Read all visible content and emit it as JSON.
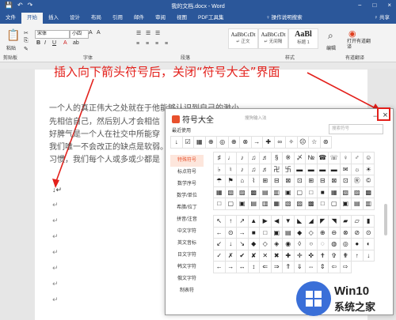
{
  "window": {
    "title": "我的文档.docx - Word",
    "qat_icons": [
      "save-icon",
      "undo-icon",
      "redo-icon"
    ],
    "controls": [
      "−",
      "□",
      "×"
    ]
  },
  "ribbon_tabs": {
    "items": [
      "文件",
      "开始",
      "插入",
      "设计",
      "布局",
      "引用",
      "邮件",
      "审阅",
      "视图",
      "PDF工具集"
    ],
    "active": "开始",
    "tell_me": "♀ 操作说明搜索",
    "share": "♀ 共享"
  },
  "ribbon": {
    "paste": "粘贴",
    "clipboard": "剪贴板",
    "font_name": "宋体",
    "font_size": "小四",
    "font": "字体",
    "paragraph": "段落",
    "styles": [
      {
        "preview": "AaBbCcDt",
        "name": "↵ 正文"
      },
      {
        "preview": "AaBbCcDt",
        "name": "↵ 无间隔"
      },
      {
        "preview": "AaBl",
        "name": "标题 1"
      }
    ],
    "styles_label": "样式",
    "edit": "编辑",
    "open_youdao": "打开有道翻译",
    "youdao_label": "有道翻译"
  },
  "annotation": "插入向下箭头符号后，关闭“符号大全”界面",
  "document": {
    "lines": [
      "一个人的真正伟大之处就在于他能够认识到自己的渺小。",
      "先相信自己，然后别人才会相信",
      "好脾气是一个人在社交中所能穿",
      "我们唯一不会改正的缺点是软弱。",
      "习惯，我们每个人或多或少都是"
    ],
    "inserted_arrow": "↓↵",
    "para_mark": "↵"
  },
  "dialog": {
    "title": "符号大全",
    "subtitle": "搜狗输入法",
    "minimize": "−",
    "close": "×",
    "recent_label": "最近使用",
    "search_placeholder": "搜索符号",
    "recent": [
      "↓",
      "☑",
      "▦",
      "⊕",
      "◎",
      "⊕",
      "⊗",
      "→",
      "✚",
      "∞",
      "✧",
      "☹",
      "☆",
      "⊛"
    ],
    "categories": [
      "特殊符号",
      "标点符号",
      "数学序号",
      "数学/单位",
      "希腊/拉丁",
      "拼音/注音",
      "中文字符",
      "英文音标",
      "日文字符",
      "韩文字符",
      "俄文字符",
      "制表符"
    ],
    "active_category": "特殊符号",
    "grid_top": [
      "♯",
      "♩",
      "♪",
      "♫",
      "♬",
      "§",
      "※",
      "〆",
      "№",
      "☎",
      "☏",
      "♀",
      "♂",
      "☺",
      "♭",
      "♮",
      "♪",
      "♫",
      "♬",
      "卍",
      "卐",
      "▬",
      "▬",
      "▬",
      "▬",
      "✉",
      "☼",
      "☀",
      "☂",
      "⚑",
      "⌂",
      "⌇",
      "⊞",
      "⊟",
      "⊠",
      "⊡",
      "⊞",
      "⊟",
      "⊠",
      "⊡",
      "Ⓡ",
      "©",
      "▦",
      "▧",
      "▨",
      "▩",
      "▤",
      "▥",
      "▣",
      "▢",
      "□",
      "■",
      "▦",
      "▧",
      "▨",
      "▩",
      "□",
      "▢",
      "▣",
      "▤",
      "▥",
      "▦",
      "▧",
      "▨",
      "▩",
      "□",
      "▢",
      "▣",
      "▤",
      "▥"
    ],
    "grid_bottom": [
      "↖",
      "↑",
      "↗",
      "▲",
      "▶",
      "◀",
      "▼",
      "◣",
      "◢",
      "◤",
      "◥",
      "▰",
      "▱",
      "▮",
      "←",
      "⊙",
      "→",
      "■",
      "□",
      "▣",
      "▤",
      "◆",
      "◇",
      "⊕",
      "⊖",
      "⊗",
      "⊘",
      "⊙",
      "↙",
      "↓",
      "↘",
      "◆",
      "◇",
      "◈",
      "◉",
      "◊",
      "○",
      "◌",
      "◍",
      "◎",
      "●",
      "◐",
      "✓",
      "✗",
      "✔",
      "✘",
      "✕",
      "✖",
      "✚",
      "✛",
      "✜",
      "✝",
      "✞",
      "✟",
      "↑",
      "↓",
      "←",
      "→",
      "↔",
      "↕",
      "⇐",
      "⇒",
      "⇑",
      "⇓",
      "⇔",
      "⇕",
      "⇦",
      "⇨"
    ]
  },
  "watermark": {
    "line1": "Win10",
    "line2": "系统之家"
  }
}
